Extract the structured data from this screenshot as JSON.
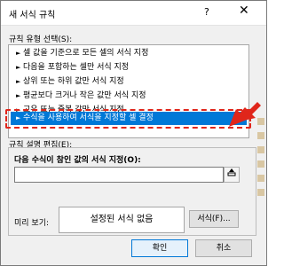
{
  "dialog": {
    "title": "새 서식 규칙",
    "help_label": "?",
    "close_label": "✕"
  },
  "rule_type": {
    "label": "규칙 유형 선택(S):",
    "items": [
      {
        "label": "셀 값을 기준으로 모든 셀의 서식 지정",
        "selected": false
      },
      {
        "label": "다음을 포함하는 셀만 서식 지정",
        "selected": false
      },
      {
        "label": "상위 또는 하위 값만 서식 지정",
        "selected": false
      },
      {
        "label": "평균보다 크거나 작은 값만 서식 지정",
        "selected": false
      },
      {
        "label": "고유 또는 중복 값만 서식 지정",
        "selected": false
      },
      {
        "label": "수식을 사용하여 서식을 지정할 셀 결정",
        "selected": true
      }
    ]
  },
  "rule_edit": {
    "label": "규칙 설명 편집(E):",
    "formula_label": "다음 수식이 참인 값의 서식 지정(O):",
    "formula_value": "",
    "collapse_icon": "collapse-dialog-icon"
  },
  "preview": {
    "label": "미리 보기:",
    "text": "설정된 서식 없음",
    "format_button": "서식(F)..."
  },
  "footer": {
    "ok": "확인",
    "cancel": "취소"
  },
  "colors": {
    "selection": "#0078d7",
    "highlight": "#e0261b"
  }
}
